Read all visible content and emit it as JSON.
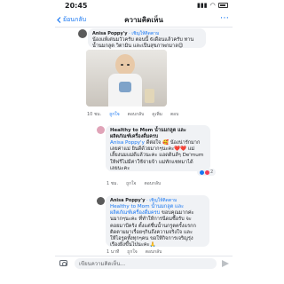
{
  "status": {
    "time": "20:45",
    "signal": "▮▮▮",
    "wifi": "◠"
  },
  "nav": {
    "back_label": "ย้อนกลับ",
    "back_icon": "chevron-left-icon",
    "title": "ความคิดเห็น",
    "more": "⋯"
  },
  "comments": [
    {
      "author": "Anisa Poppy'y",
      "invite": "· เชิญให้ติดตาม",
      "lines": [
        "น้องแพ้เต่นมวัวครับ ตอนนี้ 6เดือนแล้วครับ ทาน",
        "น้ำนมกลูต วิตามิน และเป็นสุขภาพกมาล😊"
      ],
      "actions": {
        "time": "10 ชม.",
        "like": "ถูกใจ",
        "reply": "ตอบกลับ",
        "more": "ดูเพิ่ม",
        "menu": "ตอบ"
      }
    },
    {
      "author": "Healthy to Mom น้ำนมกลูต และผลิตภัณฑ์เครื่องดื่มครบ",
      "mention": "Anisa Poppy'y",
      "lines_after_mention": "ดีต่อใจ 🥰 น้องน่ารักมาก",
      "lines": [
        "เลยค่าแม่ ยินดีด้วยมากๆนะคะ❤️❤️ แม่",
        "เลี้ยงนมแม่ดีแล้วนะคะ แอดดินส์ๆ De'mum",
        "ให้ฟรีไม่มีค่าใช้จ่ายจ้า แม่ทักแชทมาได้",
        "เลยนะคะ"
      ],
      "actions": {
        "time": "1 ชม.",
        "like": "ถูกใจ",
        "reply": "ตอบกลับ"
      },
      "reactions": "2"
    },
    {
      "author": "Anisa Poppy'y",
      "invite": "· เชิญให้ติดตาม",
      "mention_lines": [
        "Healthy to Mom น้ำนมกลูต และ",
        "ผลิตภัณฑ์เครื่องดื่มครบ"
      ],
      "lines_after_mention": "ขอบคุณมากค่ะ",
      "lines": [
        "นมากๆนะคะ ที่ทำให้การนีดมซื้อรับ จะ",
        "คอยมาบีคร้ง ตั้งแต่ชื่นน้ำนกรูตครั้งแรกก",
        "ติดตามมาเรื่อยๆกินถึงความจริงใจ และ",
        "ให้ไอรูดทั้งทุกๆคน ขอให้กิจการเจริญรุ่ง",
        "เรืองยิ่งขึ้นไปนะคะ🙏"
      ],
      "actions": {
        "time": "1 นาที",
        "like": "ถูกใจ",
        "reply": "ตอบกลับ"
      }
    }
  ],
  "composer": {
    "placeholder": "เขียนความคิดเห็น...",
    "camera": "camera-icon",
    "send": "send-icon"
  }
}
